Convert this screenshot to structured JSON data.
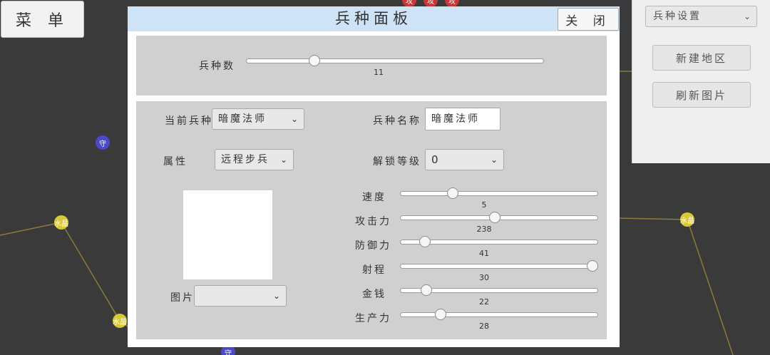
{
  "menu": {
    "label": "菜 单"
  },
  "map": {
    "nodes": [
      {
        "label": "守",
        "color": "blue"
      },
      {
        "label": "水晶",
        "color": "yellow"
      },
      {
        "label": "水晶",
        "color": "yellow"
      },
      {
        "label": "水晶",
        "color": "yellow"
      },
      {
        "label": "守",
        "color": "blue"
      },
      {
        "label": "攻",
        "color": "red"
      },
      {
        "label": "攻",
        "color": "red"
      },
      {
        "label": "攻",
        "color": "red"
      }
    ]
  },
  "side_panel": {
    "select_value": "兵种设置",
    "new_region_button": "新建地区",
    "refresh_image_button": "刷新图片"
  },
  "dialog": {
    "title": "兵种面板",
    "close_button": "关 闭",
    "troop_count": {
      "label": "兵种数",
      "value": 11,
      "min": 0,
      "max": 50
    },
    "current_troop": {
      "label": "当前兵种",
      "value": "暗魔法师"
    },
    "troop_name": {
      "label": "兵种名称",
      "value": "暗魔法师"
    },
    "attribute": {
      "label": "属性",
      "value": "远程步兵"
    },
    "unlock_level": {
      "label": "解锁等级",
      "value": "0"
    },
    "image": {
      "label": "图片",
      "value": ""
    },
    "stats": [
      {
        "label": "速度",
        "value": 5,
        "max": 20
      },
      {
        "label": "攻击力",
        "value": 238,
        "max": 500
      },
      {
        "label": "防御力",
        "value": 41,
        "max": 400
      },
      {
        "label": "射程",
        "value": 30,
        "max": 30
      },
      {
        "label": "金钱",
        "value": 22,
        "max": 200
      },
      {
        "label": "生产力",
        "value": 28,
        "max": 150
      }
    ]
  }
}
